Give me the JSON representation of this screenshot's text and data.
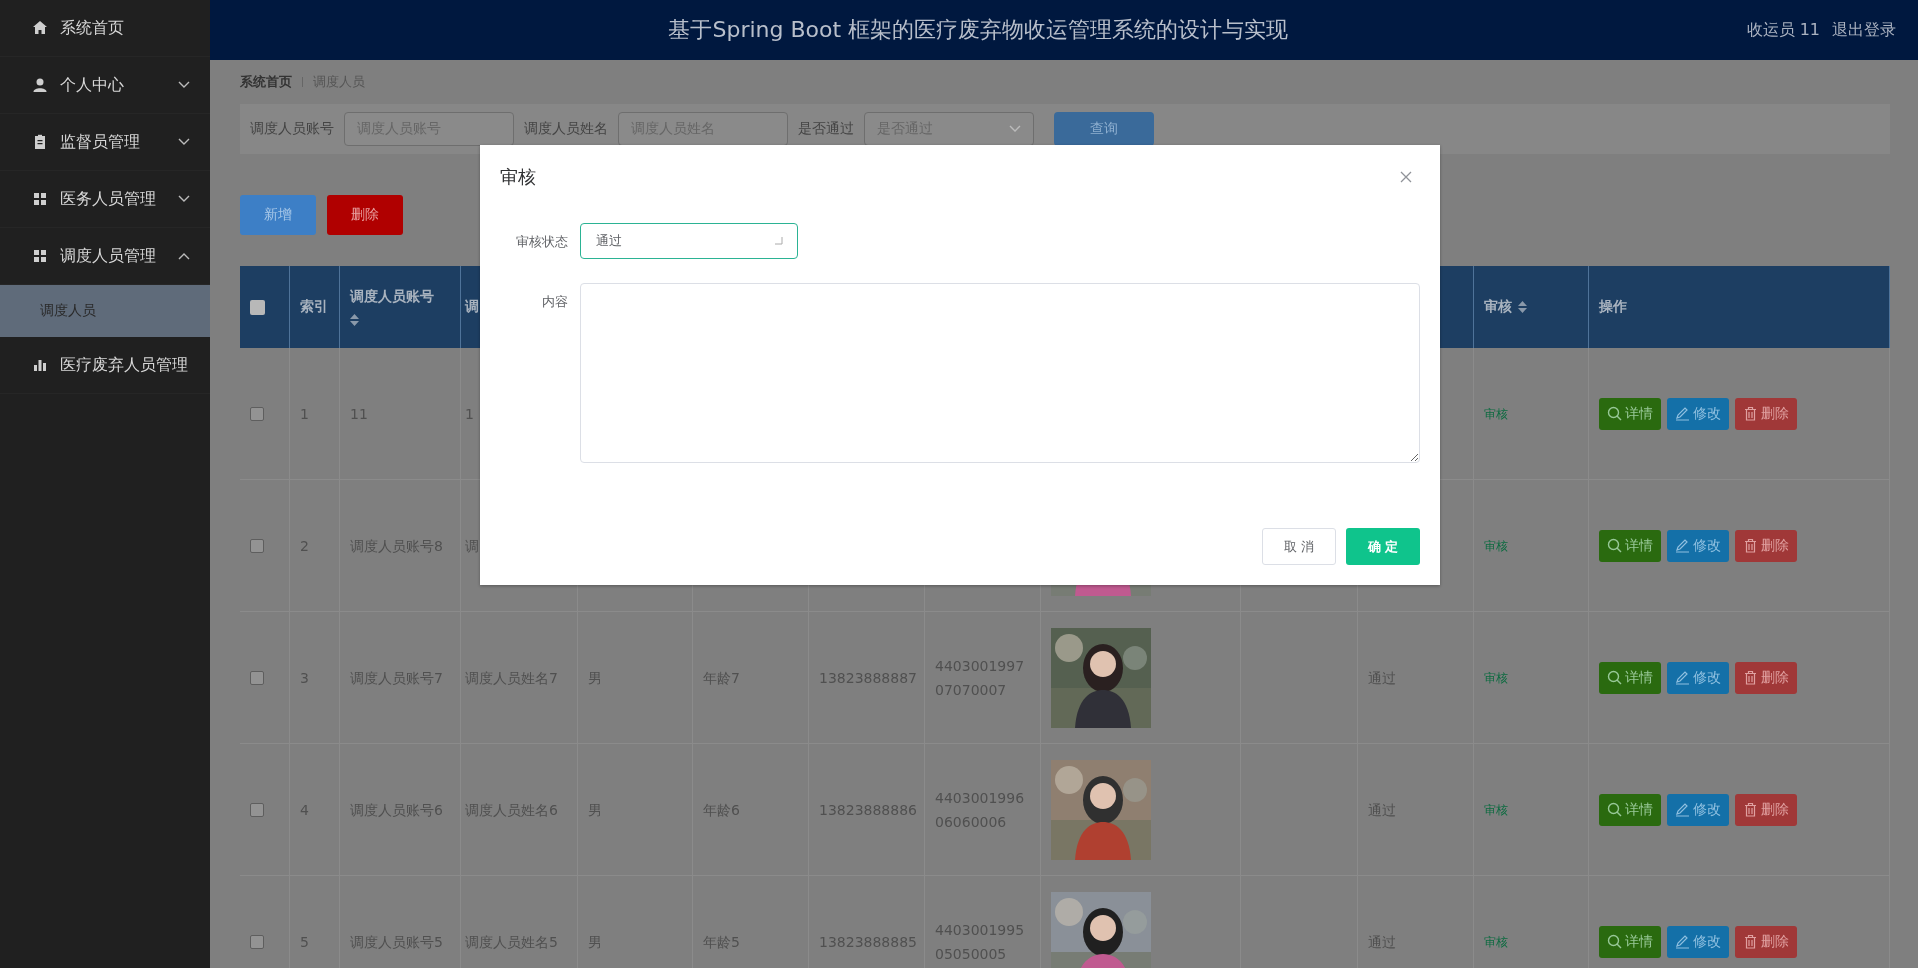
{
  "sidebar": {
    "items": [
      {
        "label": "系统首页",
        "kind": "link"
      },
      {
        "label": "个人中心",
        "kind": "menu",
        "expanded": false
      },
      {
        "label": "监督员管理",
        "kind": "menu",
        "expanded": false
      },
      {
        "label": "医务人员管理",
        "kind": "menu",
        "expanded": false
      },
      {
        "label": "调度人员管理",
        "kind": "menu",
        "expanded": true,
        "children": [
          {
            "label": "调度人员",
            "selected": true
          }
        ]
      },
      {
        "label": "医疗废弃人员管理",
        "kind": "link"
      }
    ]
  },
  "header": {
    "title": "基于Spring Boot 框架的医疗废弃物收运管理系统的设计与实现",
    "user": "收运员 11",
    "logout": "退出登录"
  },
  "breadcrumb": [
    {
      "label": "系统首页"
    },
    {
      "label": "调度人员"
    }
  ],
  "search": {
    "fields": [
      {
        "label": "调度人员账号",
        "placeholder": "调度人员账号",
        "kind": "input"
      },
      {
        "label": "调度人员姓名",
        "placeholder": "调度人员姓名",
        "kind": "input"
      },
      {
        "label": "是否通过",
        "placeholder": "是否通过",
        "kind": "select"
      }
    ],
    "query_button": "查询"
  },
  "actions": [
    {
      "label": "新增",
      "kind": "add"
    },
    {
      "label": "删除",
      "kind": "delete"
    }
  ],
  "table": {
    "header": {
      "select_all": {
        "checked": false
      },
      "index": {
        "label": "索引",
        "sortable": false
      },
      "account": {
        "label": "调度人员账号",
        "sortable": true
      },
      "name": {
        "label": "调",
        "sortable": false
      },
      "audit": {
        "label": "审核",
        "sortable": true
      },
      "actions": {
        "label": "操作",
        "sortable": false
      }
    },
    "rows": [
      {
        "checked": false,
        "index": "1",
        "account": "11",
        "name": "1",
        "audit": "审核",
        "actions": [
          "详情",
          "修改",
          "删除"
        ]
      },
      {
        "checked": false,
        "index": "2",
        "account": "调度人员账号8",
        "name": "调",
        "audit": "审核",
        "actions": [
          "详情",
          "修改",
          "删除"
        ]
      },
      {
        "checked": false,
        "index": "3",
        "account": "调度人员账号7",
        "name": "调度人员姓名7",
        "gender": "男",
        "age": "年龄7",
        "phone": "13823888887",
        "id_number": "440300199707070007",
        "status": "通过",
        "audit": "审核",
        "actions": [
          "详情",
          "修改",
          "删除"
        ]
      },
      {
        "checked": false,
        "index": "4",
        "account": "调度人员账号6",
        "name": "调度人员姓名6",
        "gender": "男",
        "age": "年龄6",
        "phone": "13823888886",
        "id_number": "440300199606060006",
        "status": "通过",
        "audit": "审核",
        "actions": [
          "详情",
          "修改",
          "删除"
        ]
      },
      {
        "checked": false,
        "index": "5",
        "account": "调度人员账号5",
        "name": "调度人员姓名5",
        "gender": "男",
        "age": "年龄5",
        "phone": "13823888885",
        "id_number": "440300199505050005",
        "status": "通过",
        "audit": "审核",
        "actions": [
          "详情",
          "修改",
          "删除"
        ]
      }
    ]
  },
  "dialog": {
    "title": "审核",
    "fields": [
      {
        "label": "审核状态",
        "kind": "select",
        "value": "通过"
      },
      {
        "label": "内容",
        "kind": "textarea"
      }
    ],
    "buttons": [
      {
        "label": "取 消",
        "kind": "cancel"
      },
      {
        "label": "确 定",
        "kind": "confirm"
      }
    ]
  }
}
